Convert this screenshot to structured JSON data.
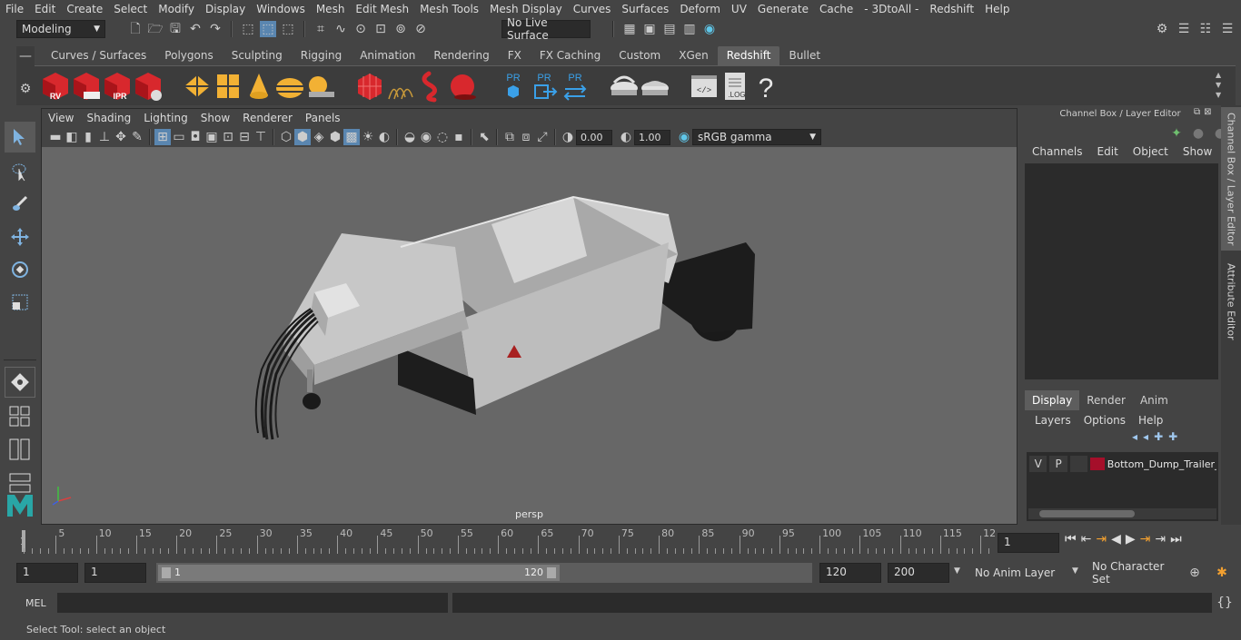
{
  "menubar": [
    "File",
    "Edit",
    "Create",
    "Select",
    "Modify",
    "Display",
    "Windows",
    "Mesh",
    "Edit Mesh",
    "Mesh Tools",
    "Mesh Display",
    "Curves",
    "Surfaces",
    "Deform",
    "UV",
    "Generate",
    "Cache",
    "- 3DtoAll -",
    "Redshift",
    "Help"
  ],
  "status": {
    "mode": "Modeling",
    "live_surface": "No Live Surface"
  },
  "shelf": {
    "tabs": [
      "Curves / Surfaces",
      "Polygons",
      "Sculpting",
      "Rigging",
      "Animation",
      "Rendering",
      "FX",
      "FX Caching",
      "Custom",
      "XGen",
      "Redshift",
      "Bullet"
    ],
    "active": "Redshift",
    "icons": {
      "rv": "RV",
      "ipr": "IPR",
      "pr": "PR",
      "log": ".LOG",
      "help": "?"
    }
  },
  "viewport": {
    "menu": [
      "View",
      "Shading",
      "Lighting",
      "Show",
      "Renderer",
      "Panels"
    ],
    "exposure": "0.00",
    "gamma": "1.00",
    "color_space": "sRGB gamma",
    "camera": "persp",
    "bg_color": "#676767"
  },
  "channelbox": {
    "title": "Channel Box / Layer Editor",
    "menu": [
      "Channels",
      "Edit",
      "Object",
      "Show"
    ],
    "layer_tabs": [
      "Display",
      "Render",
      "Anim"
    ],
    "layer_tab_active": "Display",
    "layer_menu": [
      "Layers",
      "Options",
      "Help"
    ],
    "layer": {
      "v": "V",
      "p": "P",
      "name": "Bottom_Dump_Trailer_",
      "color": "#a50f2a"
    }
  },
  "sidetabs": [
    "Channel Box / Layer Editor",
    "Attribute Editor"
  ],
  "timeline": {
    "ticks": [
      "5",
      "10",
      "15",
      "20",
      "25",
      "30",
      "35",
      "40",
      "45",
      "50",
      "55",
      "60",
      "65",
      "70",
      "75",
      "80",
      "85",
      "90",
      "95",
      "100",
      "105",
      "110",
      "115",
      "12"
    ],
    "first_frame": "1",
    "current_frame": "1"
  },
  "range": {
    "start": "1",
    "start2": "1",
    "slider_start": "1",
    "slider_end": "120",
    "end": "120",
    "end2": "200",
    "anim_layer": "No Anim Layer",
    "char_set": "No Character Set"
  },
  "cmd": {
    "label": "MEL"
  },
  "help_text": "Select Tool: select an object"
}
